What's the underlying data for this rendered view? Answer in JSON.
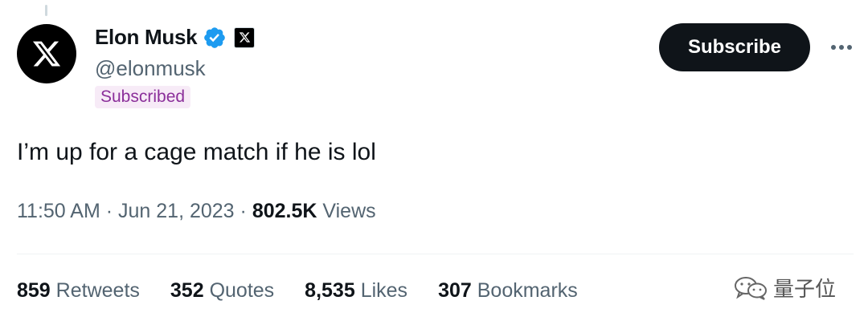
{
  "author": {
    "name": "Elon Musk",
    "handle": "@elonmusk",
    "subscribed_label": "Subscribed",
    "avatar_icon": "x-logo-icon",
    "verified_icon": "verified-badge-icon",
    "affiliation_icon": "x-affiliate-badge-icon"
  },
  "actions": {
    "subscribe_label": "Subscribe",
    "more_icon": "more-options-icon"
  },
  "tweet": {
    "text": "I’m up for a cage match if he is lol",
    "time": "11:50 AM",
    "separator": "·",
    "date": "Jun 21, 2023",
    "views_count": "802.5K",
    "views_label": "Views"
  },
  "stats": [
    {
      "count": "859",
      "label": "Retweets"
    },
    {
      "count": "352",
      "label": "Quotes"
    },
    {
      "count": "8,535",
      "label": "Likes"
    },
    {
      "count": "307",
      "label": "Bookmarks"
    }
  ],
  "watermark": {
    "text": "量子位",
    "icon": "wechat-icon"
  },
  "colors": {
    "text": "#0f1419",
    "secondary": "#536471",
    "verified": "#1d9bf0",
    "subscribed_bg": "#f7ebf7",
    "subscribed_text": "#8b2f9a",
    "button_bg": "#0f1419"
  }
}
